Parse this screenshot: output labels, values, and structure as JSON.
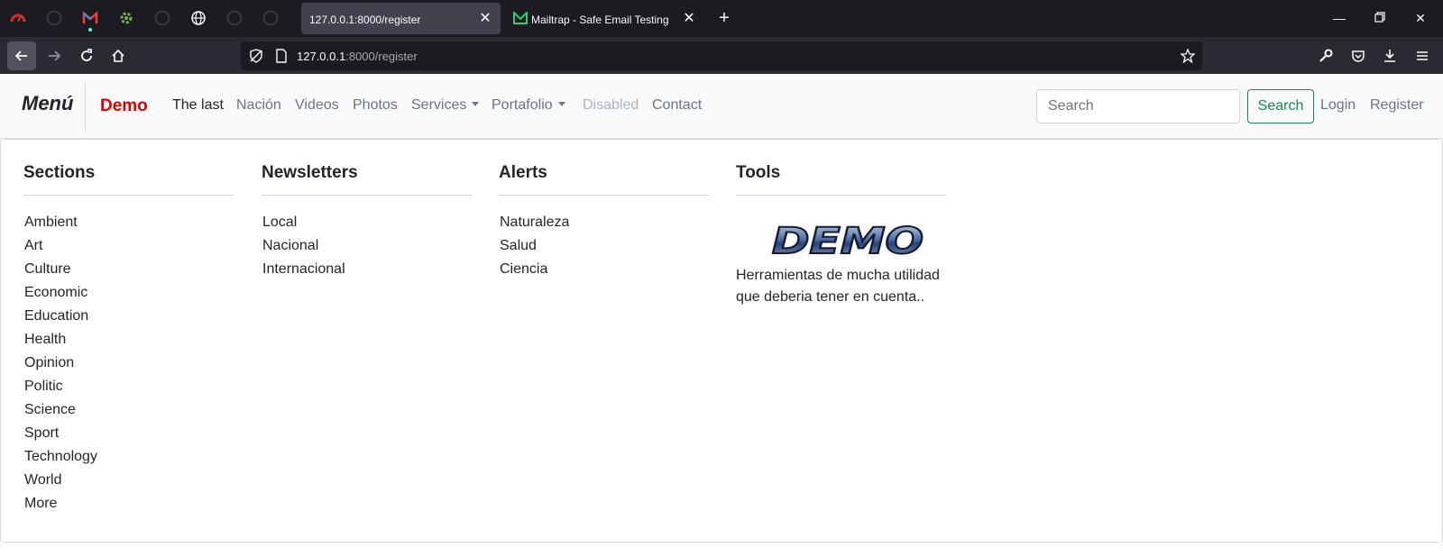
{
  "browser": {
    "tabs": [
      {
        "title": "127.0.0.1:8000/register",
        "active": true
      },
      {
        "title": "Mailtrap - Safe Email Testing",
        "active": false
      }
    ],
    "url": {
      "host": "127.0.0.1",
      "path": ":8000/register"
    }
  },
  "navbar": {
    "brand": "Menú",
    "brand_secondary": "Demo",
    "links": [
      {
        "label": "The last"
      },
      {
        "label": "Nación"
      },
      {
        "label": "Videos"
      },
      {
        "label": "Photos"
      },
      {
        "label": "Services"
      },
      {
        "label": "Portafolio"
      },
      {
        "label": "Disabled"
      },
      {
        "label": "Contact"
      }
    ],
    "search_placeholder": "Search",
    "search_button": "Search",
    "login": "Login",
    "register": "Register"
  },
  "mega_menu": {
    "sections": {
      "title": "Sections",
      "items": [
        "Ambient",
        "Art",
        "Culture",
        "Economic",
        "Education",
        "Health",
        "Opinion",
        "Politic",
        "Science",
        "Sport",
        "Technology",
        "World",
        "More"
      ]
    },
    "newsletters": {
      "title": "Newsletters",
      "items": [
        "Local",
        "Nacional",
        "Internacional"
      ]
    },
    "alerts": {
      "title": "Alerts",
      "items": [
        "Naturaleza",
        "Salud",
        "Ciencia"
      ]
    },
    "tools": {
      "title": "Tools",
      "logo_text": "DEMO",
      "text": "Herramientas de mucha utilidad que deberia tener en cuenta.."
    }
  },
  "colors": {
    "brand_red": "#e00000",
    "success_green": "#198754",
    "browser_dark": "#1c1b22"
  }
}
